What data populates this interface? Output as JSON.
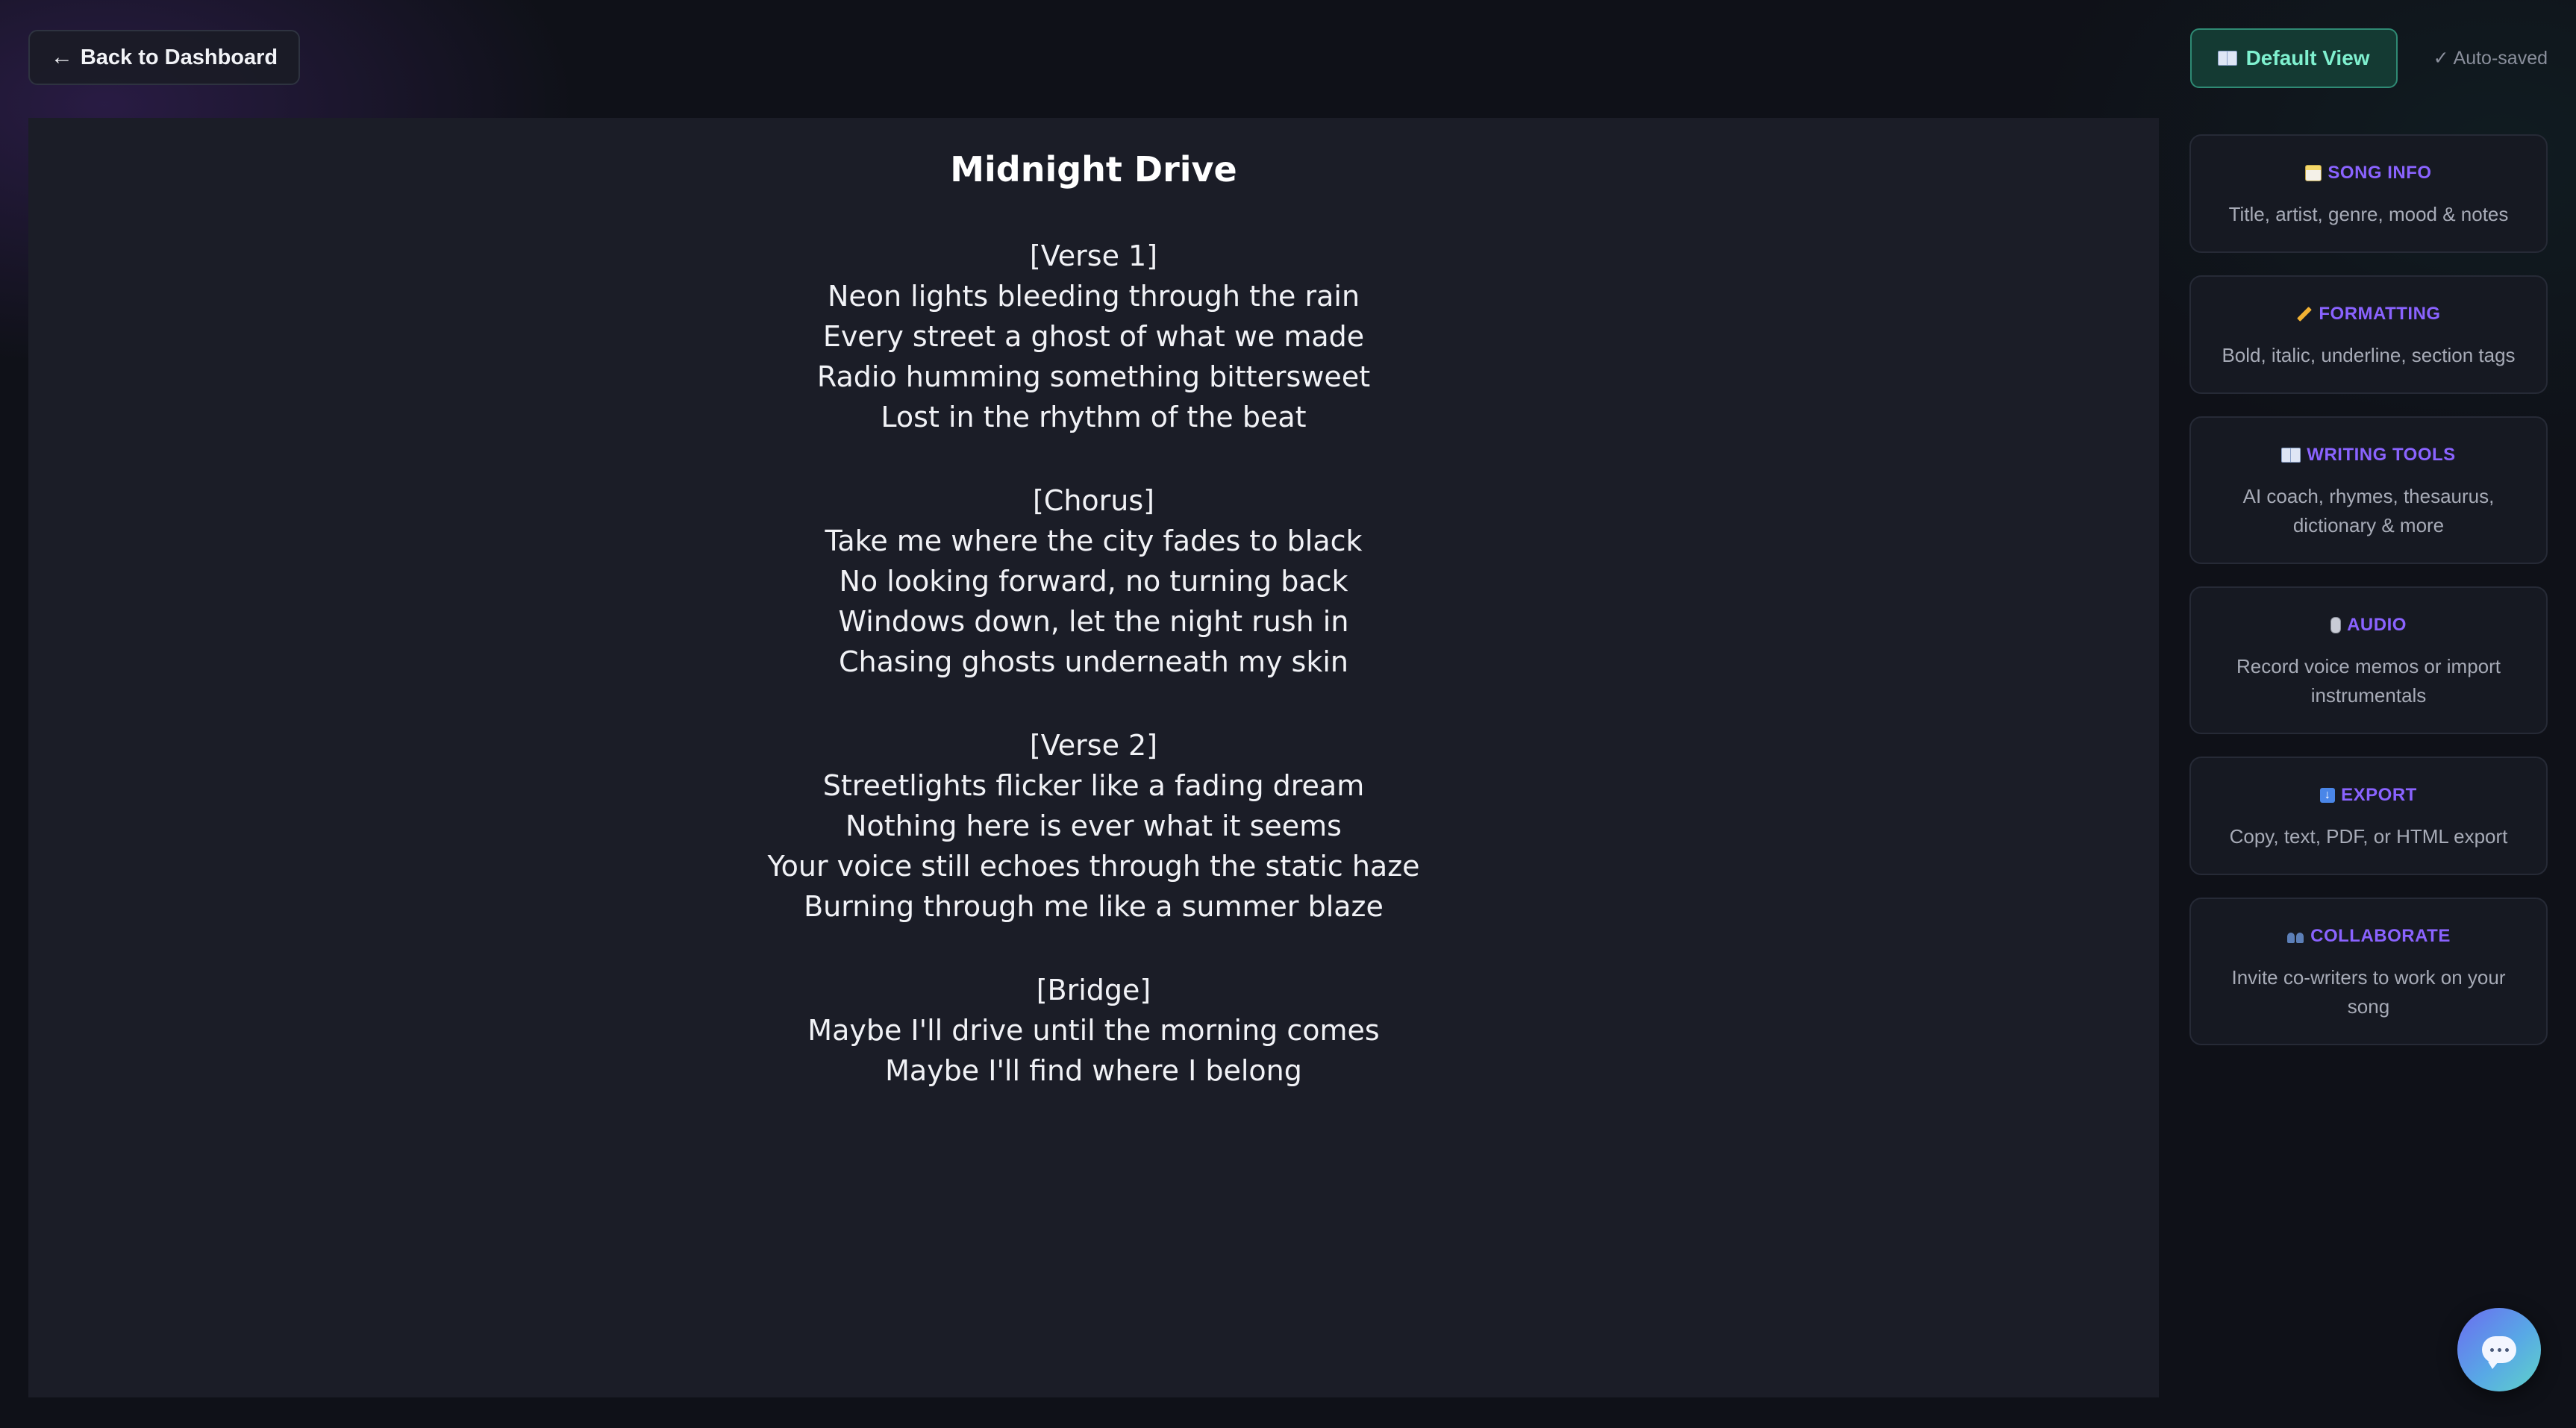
{
  "header": {
    "back_label": "Back to Dashboard",
    "view_label": "Default View",
    "autosave_label": "Auto-saved"
  },
  "song": {
    "title": "Midnight Drive",
    "sections": [
      {
        "tag": "[Verse 1]",
        "lines": [
          "Neon lights bleeding through the rain",
          "Every street a ghost of what we made",
          "Radio humming something bittersweet",
          "Lost in the rhythm of the beat"
        ]
      },
      {
        "tag": "[Chorus]",
        "lines": [
          "Take me where the city fades to black",
          "No looking forward, no turning back",
          "Windows down, let the night rush in",
          "Chasing ghosts underneath my skin"
        ]
      },
      {
        "tag": "[Verse 2]",
        "lines": [
          "Streetlights flicker like a fading dream",
          "Nothing here is ever what it seems",
          "Your voice still echoes through the static haze",
          "Burning through me like a summer blaze"
        ]
      },
      {
        "tag": "[Bridge]",
        "lines": [
          "Maybe I'll drive until the morning comes",
          "Maybe I'll find where I belong"
        ]
      }
    ]
  },
  "sidebar": {
    "cards": [
      {
        "title": "SONG INFO",
        "description": "Title, artist, genre, mood & notes",
        "icon": "notepad-icon"
      },
      {
        "title": "FORMATTING",
        "description": "Bold, italic, underline, section tags",
        "icon": "pencil-icon"
      },
      {
        "title": "WRITING TOOLS",
        "description": "AI coach, rhymes, thesaurus, dictionary & more",
        "icon": "book-icon"
      },
      {
        "title": "AUDIO",
        "description": "Record voice memos or import instrumentals",
        "icon": "microphone-icon"
      },
      {
        "title": "EXPORT",
        "description": "Copy, text, PDF, or HTML export",
        "icon": "download-icon"
      },
      {
        "title": "COLLABORATE",
        "description": "Invite co-writers to work on your song",
        "icon": "people-icon"
      }
    ]
  },
  "colors": {
    "accent_purple": "#8a63ff",
    "accent_teal": "#7ff0cf",
    "editor_bg": "#1b1d27"
  }
}
